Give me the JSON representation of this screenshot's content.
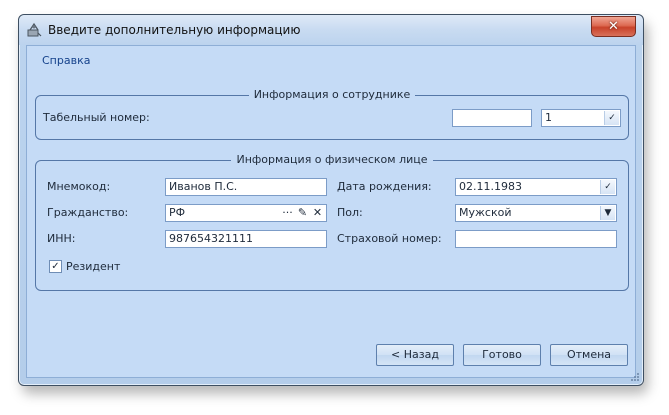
{
  "window": {
    "title": "Введите дополнительную информацию",
    "close_glyph": "✕"
  },
  "menu": {
    "help": "Справка"
  },
  "employee_group": {
    "legend": "Информация о сотруднике",
    "tab_number_label": "Табельный номер:",
    "tab_number_value": "",
    "combo_value": "1"
  },
  "person_group": {
    "legend": "Информация о физическом лице",
    "mnemocode_label": "Мнемокод:",
    "mnemocode_value": "Иванов П.С.",
    "citizenship_label": "Гражданство:",
    "citizenship_value": "РФ",
    "inn_label": "ИНН:",
    "inn_value": "987654321111",
    "birth_label": "Дата рождения:",
    "birth_value": "02.11.1983",
    "sex_label": "Пол:",
    "sex_value": "Мужской",
    "insurance_label": "Страховой номер:",
    "insurance_value": "",
    "resident_label": "Резидент",
    "resident_checked": true
  },
  "buttons": {
    "back": "< Назад",
    "finish": "Готово",
    "cancel": "Отмена"
  },
  "icons": {
    "check": "✓",
    "dropdown": "▼",
    "ellipsis": "···",
    "edit": "✎",
    "clear": "✕"
  },
  "colors": {
    "accent": "#15428b",
    "border": "#5577a7",
    "background": "#c5dbf6"
  }
}
